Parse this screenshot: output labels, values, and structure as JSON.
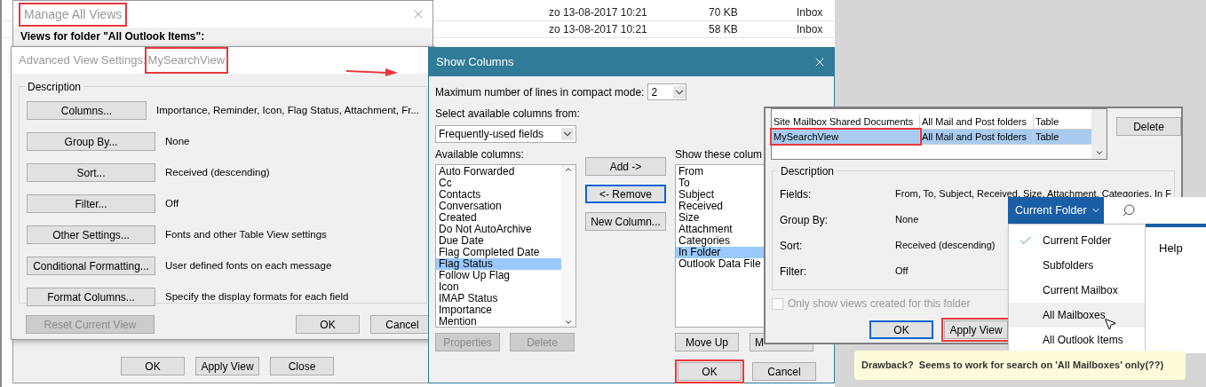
{
  "mail_list": {
    "rows": [
      {
        "received": "zo 13-08-2017 10:21",
        "size": "70 KB",
        "folder": "Inbox"
      },
      {
        "received": "zo 13-08-2017 10:21",
        "size": "58 KB",
        "folder": "Inbox"
      }
    ]
  },
  "manage_views": {
    "title": "Manage All Views",
    "title_highlighted": true,
    "heading": "Views for folder \"All Outlook Items\":",
    "buttons": [
      "OK",
      "Apply View",
      "Close"
    ]
  },
  "advanced_settings": {
    "title": "Advanced View Settings: ",
    "view_name": "MySearchView",
    "view_name_highlighted": true,
    "group_label": "Description",
    "settings": [
      {
        "button": "Columns...",
        "value": "Importance, Reminder, Icon, Flag Status, Attachment, Fr..."
      },
      {
        "button": "Group By...",
        "value": "None"
      },
      {
        "button": "Sort...",
        "value": "Received (descending)"
      },
      {
        "button": "Filter...",
        "value": "Off"
      },
      {
        "button": "Other Settings...",
        "value": "Fonts and other Table View settings"
      },
      {
        "button": "Conditional Formatting...",
        "value": "User defined fonts on each message"
      },
      {
        "button": "Format Columns...",
        "value": "Specify the display formats for each field"
      }
    ],
    "reset_button": {
      "label": "Reset Current View",
      "disabled": true
    },
    "buttons": [
      "OK",
      "Cancel"
    ]
  },
  "show_columns": {
    "title": "Show Columns",
    "max_lines_label": "Maximum number of lines in compact mode:",
    "max_lines_value": "2",
    "source_label": "Select available columns from:",
    "source_value": "Frequently-used fields",
    "available_label": "Available columns:",
    "available": [
      {
        "label": "Auto Forwarded",
        "selected": false
      },
      {
        "label": "Cc",
        "selected": false
      },
      {
        "label": "Contacts",
        "selected": false
      },
      {
        "label": "Conversation",
        "selected": false
      },
      {
        "label": "Created",
        "selected": false
      },
      {
        "label": "Do Not AutoArchive",
        "selected": false
      },
      {
        "label": "Due Date",
        "selected": false
      },
      {
        "label": "Flag Completed Date",
        "selected": false
      },
      {
        "label": "Flag Status",
        "selected": true
      },
      {
        "label": "Follow Up Flag",
        "selected": false
      },
      {
        "label": "Icon",
        "selected": false
      },
      {
        "label": "IMAP Status",
        "selected": false
      },
      {
        "label": "Importance",
        "selected": false
      },
      {
        "label": "Mention",
        "selected": false
      }
    ],
    "middle_buttons": [
      {
        "label": "Add ->",
        "default": false
      },
      {
        "label": "<- Remove",
        "default": true
      },
      {
        "label": "New Column...",
        "default": false
      }
    ],
    "shown_label": "Show these colum",
    "shown": [
      {
        "label": "From",
        "selected": false
      },
      {
        "label": "To",
        "selected": false
      },
      {
        "label": "Subject",
        "selected": false
      },
      {
        "label": "Received",
        "selected": false
      },
      {
        "label": "Size",
        "selected": false
      },
      {
        "label": "Attachment",
        "selected": false
      },
      {
        "label": "Categories",
        "selected": false
      },
      {
        "label": "In Folder",
        "selected": true
      },
      {
        "label": "Outlook Data File",
        "selected": false
      }
    ],
    "left_buttons": [
      {
        "label": "Properties",
        "disabled": true
      },
      {
        "label": "Delete",
        "disabled": true
      }
    ],
    "right_buttons": [
      {
        "label": "Move Up",
        "disabled": false
      },
      {
        "label": "M",
        "disabled": false
      }
    ],
    "buttons": [
      {
        "label": "OK",
        "highlighted": true
      },
      {
        "label": "Cancel",
        "highlighted": false
      }
    ]
  },
  "views_panel": {
    "rows": [
      {
        "name": "Site Mailbox Shared Documents",
        "location": "All Mail and Post folders",
        "type": "Table",
        "selected": false,
        "highlighted": false
      },
      {
        "name": "MySearchView",
        "location": "All Mail and Post folders",
        "type": "Table",
        "selected": true,
        "highlighted": true
      }
    ],
    "delete_button": "Delete",
    "group_label": "Description",
    "fields": [
      {
        "label": "Fields:",
        "value": "From, To, Subject, Received, Size, Attachment, Categories, In F"
      },
      {
        "label": "Group By:",
        "value": "None"
      },
      {
        "label": "Sort:",
        "value": "Received (descending)"
      },
      {
        "label": "Filter:",
        "value": "Off"
      }
    ],
    "only_this_folder": {
      "label": "Only show views created for this folder",
      "checked": false,
      "disabled": true
    },
    "buttons": [
      {
        "label": "OK",
        "default": true,
        "highlighted": false
      },
      {
        "label": "Apply View",
        "default": false,
        "highlighted": true
      }
    ]
  },
  "search_scope": {
    "button": "Current Folder",
    "options": [
      {
        "label": "Current Folder",
        "checked": true,
        "hovered": false
      },
      {
        "label": "Subfolders",
        "checked": false,
        "hovered": false
      },
      {
        "label": "Current Mailbox",
        "checked": false,
        "hovered": false
      },
      {
        "label": "All Mailboxes",
        "checked": false,
        "hovered": true
      },
      {
        "label": "All Outlook Items",
        "checked": false,
        "hovered": false
      }
    ]
  },
  "ribbon": {
    "tab": "Help"
  },
  "note": {
    "text": "Drawback?  Seems to work for search on 'All Mailboxes' only(??)"
  }
}
